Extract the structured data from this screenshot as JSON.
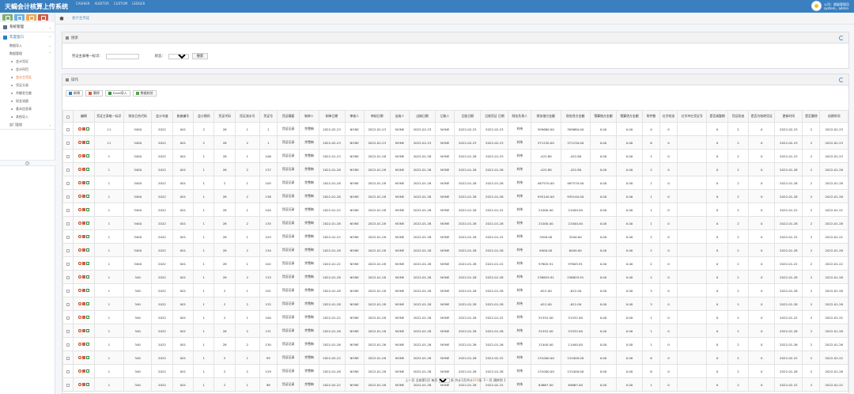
{
  "header": {
    "title": "天蝎会计核算上传系统",
    "links": [
      "CASHIER",
      "AUDITOR",
      "CUSTOM",
      "LEDGER"
    ],
    "user_line1": "公司：超级管理员",
    "user_line2": "system，admin"
  },
  "sidebar": {
    "menus": [
      {
        "label": "系统管理"
      },
      {
        "label": "年度窗口"
      },
      {
        "label": "数据导入"
      },
      {
        "label": "数据管理"
      },
      {
        "label": "部门管理"
      }
    ],
    "sub_items": [
      "会计凭证",
      "会计科目",
      "会计主凭证",
      "凭证分录",
      "余额发生额",
      "现金流量",
      "基本信息表",
      "其他导入"
    ]
  },
  "breadcrumb": {
    "current": "会计主凭证"
  },
  "search": {
    "title": "搜索",
    "field1_label": "凭证主表唯一标识：",
    "field1_value": "",
    "field2_label": "状态：",
    "field2_value": "",
    "button": "搜索"
  },
  "toolbar": {
    "title": "操作",
    "add": "新增",
    "delete": "删除",
    "excel": "Excel导入",
    "check": "数据校验"
  },
  "table": {
    "columns": [
      "",
      "编辑",
      "凭证主表唯一标识",
      "财务日合代码",
      "会计年度",
      "账套编号",
      "会计期间",
      "凭证代码",
      "凭证流水号",
      "凭证号",
      "凭证摘要",
      "制单人",
      "制单日期",
      "审核人",
      "审核日期",
      "出纳人",
      "出纳日期",
      "记账人",
      "记账日期",
      "记账凭证 日期",
      "财务负责人",
      "财务借方金额",
      "财务贷方金额",
      "预算借方金额",
      "预算贷方金额",
      "附件数",
      "红字状态",
      "红字冲红凭证号",
      "是否调整期",
      "凭证状态",
      "是否为结转凭证",
      "更新时间",
      "是否删除",
      "创建时间"
    ],
    "rows": [
      [
        "11",
        "3400",
        "2022",
        "001",
        "2",
        "28",
        "1",
        "1",
        "凭证记录",
        "余雪梅",
        "2022-02-23",
        "NONE",
        "2022-02-23",
        "NONE",
        "2022-02-23",
        "NONE",
        "2022-02-23",
        "2022-02-23",
        "刘伟",
        "309680.00",
        "309680.00",
        "0.00",
        "0.00",
        "0",
        "0",
        "",
        "0",
        "2",
        "0",
        "2022-02-23",
        "2",
        "2022-02-23"
      ],
      [
        "11",
        "3400",
        "2022",
        "001",
        "2",
        "28",
        "2",
        "1",
        "凭证记录",
        "余雪梅",
        "2022-02-23",
        "NONE",
        "2022-02-23",
        "NONE",
        "2022-02-23",
        "NONE",
        "2022-02-23",
        "2022-02-23",
        "刘伟",
        "371230.00",
        "371230.00",
        "0.00",
        "0.00",
        "6",
        "0",
        "",
        "0",
        "2",
        "0",
        "2022-02-23",
        "2",
        "2022-02-23"
      ],
      [
        "1",
        "3400",
        "2022",
        "001",
        "1",
        "28",
        "1",
        "106",
        "凭证记录",
        "余雪梅",
        "2022-01-23",
        "NONE",
        "2022-01-28",
        "NONE",
        "2022-01-28",
        "NONE",
        "2022-01-28",
        "2022-01-23",
        "刘伟",
        "-422.80",
        "-422.80",
        "0.00",
        "0.00",
        "1",
        "0",
        "",
        "0",
        "2",
        "0",
        "2022-01-23",
        "2",
        "2022-01-23"
      ],
      [
        "1",
        "3400",
        "2022",
        "001",
        "1",
        "28",
        "2",
        "137",
        "凭证记录",
        "余雪梅",
        "2022-01-28",
        "NONE",
        "2022-01-28",
        "NONE",
        "2022-01-28",
        "NONE",
        "2022-01-28",
        "2022-01-28",
        "刘伟",
        "-422.80",
        "-422.80",
        "0.00",
        "0.00",
        "2",
        "0",
        "",
        "0",
        "2",
        "0",
        "2022-01-28",
        "2",
        "2022-01-28"
      ],
      [
        "1",
        "3400",
        "2022",
        "001",
        "1",
        "2",
        "1",
        "105",
        "凭证记录",
        "余雪梅",
        "2022-01-28",
        "NONE",
        "2022-01-28",
        "NONE",
        "2022-01-28",
        "NONE",
        "2022-01-28",
        "2022-01-28",
        "刘伟",
        "467570.00",
        "467570.00",
        "0.00",
        "0.00",
        "1",
        "0",
        "",
        "0",
        "2",
        "0",
        "2022-01-28",
        "2",
        "2022-01-28"
      ],
      [
        "1",
        "3400",
        "2022",
        "001",
        "1",
        "28",
        "2",
        "136",
        "凭证记录",
        "余雪梅",
        "2022-01-28",
        "NONE",
        "2022-01-28",
        "NONE",
        "2022-01-28",
        "NONE",
        "2022-01-28",
        "2022-01-28",
        "刘伟",
        "935140.00",
        "935140.00",
        "0.00",
        "0.00",
        "1",
        "0",
        "",
        "0",
        "2",
        "0",
        "2022-01-28",
        "2",
        "2022-01-28"
      ],
      [
        "1",
        "3400",
        "2022",
        "001",
        "1",
        "28",
        "1",
        "104",
        "凭证记录",
        "余雪梅",
        "2022-01-22",
        "NONE",
        "2022-01-28",
        "NONE",
        "2022-01-28",
        "NONE",
        "2022-01-28",
        "2022-01-22",
        "刘伟",
        "21000.00",
        "21000.00",
        "0.00",
        "0.00",
        "1",
        "0",
        "",
        "0",
        "2",
        "0",
        "2022-01-22",
        "2",
        "2022-01-22"
      ],
      [
        "1",
        "3400",
        "2022",
        "001",
        "1",
        "28",
        "2",
        "135",
        "凭证记录",
        "余雪梅",
        "2022-01-28",
        "NONE",
        "2022-01-28",
        "NONE",
        "2022-01-28",
        "NONE",
        "2022-01-28",
        "2022-01-28",
        "刘伟",
        "21000.00",
        "21000.00",
        "0.00",
        "0.00",
        "1",
        "0",
        "",
        "0",
        "2",
        "0",
        "2022-01-28",
        "2",
        "2022-01-28"
      ],
      [
        "1",
        "3400",
        "2022",
        "001",
        "1",
        "28",
        "1",
        "103",
        "凭证记录",
        "余雪梅",
        "2022-01-22",
        "NONE",
        "2022-01-28",
        "NONE",
        "2022-01-28",
        "NONE",
        "2022-01-28",
        "2022-01-22",
        "刘伟",
        "3200.00",
        "3200.00",
        "0.00",
        "0.00",
        "2",
        "0",
        "",
        "0",
        "2",
        "0",
        "2022-01-22",
        "2",
        "2022-01-22"
      ],
      [
        "1",
        "3400",
        "2022",
        "001",
        "1",
        "28",
        "2",
        "134",
        "凭证记录",
        "余雪梅",
        "2022-01-28",
        "NONE",
        "2022-01-28",
        "NONE",
        "2022-01-28",
        "NONE",
        "2022-01-28",
        "2022-01-28",
        "刘伟",
        "6400.00",
        "6400.00",
        "0.00",
        "0.00",
        "2",
        "0",
        "",
        "0",
        "2",
        "0",
        "2022-01-28",
        "2",
        "2022-01-28"
      ],
      [
        "1",
        "3400",
        "2022",
        "001",
        "1",
        "28",
        "1",
        "102",
        "凭证记录",
        "余雪梅",
        "2022-01-22",
        "NONE",
        "2022-01-28",
        "NONE",
        "2022-01-28",
        "NONE",
        "2022-01-28",
        "2022-01-22",
        "刘伟",
        "97605.91",
        "97605.91",
        "0.00",
        "0.00",
        "2",
        "0",
        "",
        "0",
        "2",
        "0",
        "2022-01-22",
        "2",
        "2022-01-22"
      ],
      [
        "1",
        "340",
        "2022",
        "001",
        "1",
        "28",
        "2",
        "133",
        "凭证记录",
        "余雪梅",
        "2022-01-28",
        "NONE",
        "2022-01-28",
        "NONE",
        "2022-01-28",
        "NONE",
        "2022-01-28",
        "2022-01-28",
        "刘伟",
        "238829.91",
        "238829.91",
        "0.00",
        "0.00",
        "2",
        "0",
        "",
        "0",
        "2",
        "0",
        "2022-01-28",
        "2",
        "2022-01-28"
      ],
      [
        "1",
        "340",
        "2022",
        "001",
        "1",
        "2",
        "1",
        "101",
        "凭证记录",
        "余雪梅",
        "2022-01-28",
        "NONE",
        "2022-01-28",
        "NONE",
        "2022-01-28",
        "NONE",
        "2022-01-28",
        "2022-01-28",
        "刘伟",
        "-612.00",
        "-612.00",
        "0.00",
        "0.00",
        "3",
        "0",
        "",
        "0",
        "2",
        "0",
        "2022-01-28",
        "2",
        "2022-01-28"
      ],
      [
        "1",
        "340",
        "2022",
        "001",
        "1",
        "2",
        "2",
        "132",
        "凭证记录",
        "余雪梅",
        "2022-01-28",
        "NONE",
        "2022-01-28",
        "NONE",
        "2022-01-28",
        "NONE",
        "2022-01-28",
        "2022-01-28",
        "刘伟",
        "-612.00",
        "-612.00",
        "0.00",
        "0.00",
        "3",
        "0",
        "",
        "0",
        "2",
        "0",
        "2022-01-28",
        "2",
        "2022-01-28"
      ],
      [
        "1",
        "340",
        "2022",
        "001",
        "1",
        "2",
        "1",
        "100",
        "凭证记录",
        "余雪梅",
        "2022-01-22",
        "NONE",
        "2022-01-28",
        "NONE",
        "2022-01-28",
        "NONE",
        "2022-01-28",
        "2022-01-22",
        "刘伟",
        "51552.00",
        "51552.00",
        "0.00",
        "0.00",
        "1",
        "0",
        "",
        "0",
        "2",
        "0",
        "2022-01-22",
        "2",
        "2022-01-22"
      ],
      [
        "1",
        "340",
        "2022",
        "001",
        "1",
        "28",
        "2",
        "131",
        "凭证记录",
        "余雪梅",
        "2022-01-28",
        "NONE",
        "2022-01-28",
        "NONE",
        "2022-01-28",
        "NONE",
        "2022-01-28",
        "2022-01-28",
        "刘伟",
        "51552.00",
        "51552.00",
        "0.00",
        "0.00",
        "1",
        "0",
        "",
        "0",
        "2",
        "0",
        "2022-01-28",
        "2",
        "2022-01-28"
      ],
      [
        "1",
        "340",
        "2022",
        "001",
        "1",
        "28",
        "2",
        "130",
        "凭证记录",
        "余雪梅",
        "2022-01-26",
        "NONE",
        "2022-01-26",
        "NONE",
        "2022-01-26",
        "NONE",
        "2022-01-26",
        "2022-01-26",
        "刘伟",
        "11400.00",
        "11400.00",
        "0.00",
        "0.00",
        "1",
        "0",
        "",
        "0",
        "2",
        "0",
        "2022-01-26",
        "2",
        "2022-01-26"
      ],
      [
        "1",
        "340",
        "2022",
        "001",
        "1",
        "2",
        "1",
        "99",
        "凭证记录",
        "余雪梅",
        "2022-02-22",
        "NONE",
        "2022-01-28",
        "NONE",
        "2022-01-28",
        "NONE",
        "2022-01-28",
        "2022-02-22",
        "刘伟",
        "131000.00",
        "131000.00",
        "0.00",
        "0.00",
        "6",
        "0",
        "",
        "0",
        "2",
        "0",
        "2022-02-22",
        "2",
        "2022-02-22"
      ],
      [
        "1",
        "340",
        "2022",
        "001",
        "1",
        "2",
        "2",
        "129",
        "凭证记录",
        "余雪梅",
        "2022-01-28",
        "NONE",
        "2022-01-28",
        "NONE",
        "2022-01-28",
        "NONE",
        "2022-01-28",
        "2022-01-28",
        "刘伟",
        "131000.00",
        "131000.00",
        "0.00",
        "0.00",
        "6",
        "0",
        "",
        "0",
        "2",
        "0",
        "2022-01-28",
        "2",
        "2022-01-28"
      ],
      [
        "1",
        "340",
        "2022",
        "001",
        "1",
        "2",
        "1",
        "98",
        "凭证记录",
        "余雪梅",
        "2022-02-22",
        "NONE",
        "2022-01-28",
        "NONE",
        "2022-01-28",
        "NONE",
        "2022-01-28",
        "2022-02-22",
        "刘伟",
        "84667.00",
        "84667.00",
        "0.00",
        "0.00",
        "1",
        "0",
        "",
        "0",
        "2",
        "0",
        "2022-02-22",
        "2",
        "2022-02-22"
      ]
    ]
  },
  "pager": {
    "prev": "上一页",
    "page_label": "当前第1页",
    "per_page_label": "每页",
    "per_page_value": "20",
    "per_page_unit": "条",
    "total_label": "共计1页",
    "total_records_prefix": "共计",
    "total_records": "215",
    "total_records_suffix": "条",
    "next": "下一页",
    "jump_label": "跳转到",
    "jump_value": "1"
  }
}
